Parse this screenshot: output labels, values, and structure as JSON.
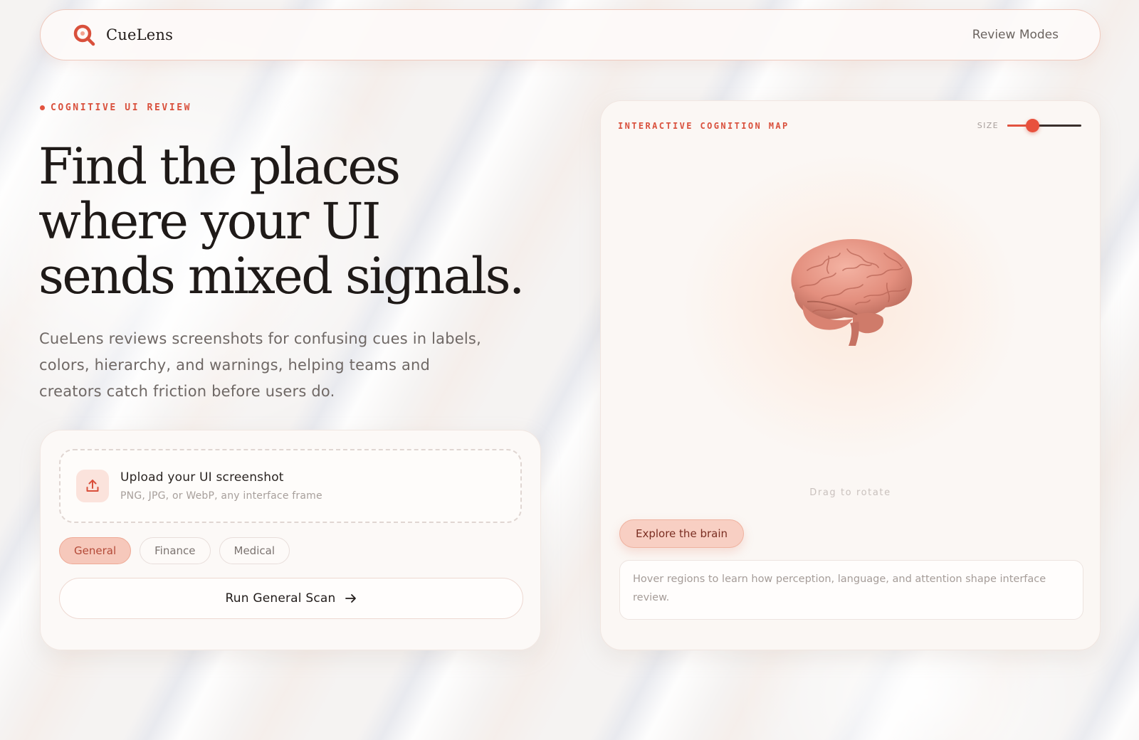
{
  "nav": {
    "brand_name": "CueLens",
    "review_modes": "Review Modes"
  },
  "hero": {
    "eyebrow": "COGNITIVE UI REVIEW",
    "headline_lines": [
      "Find the places",
      "where your UI",
      "sends mixed signals."
    ],
    "lede": "CueLens reviews screenshots for confusing cues in labels, colors, hierarchy, and warnings, helping teams and creators catch friction before users do."
  },
  "upload": {
    "title": "Upload your UI screenshot",
    "subtitle": "PNG, JPG, or WebP, any interface frame",
    "icon": "upload-icon",
    "modes": [
      {
        "label": "General",
        "active": true
      },
      {
        "label": "Finance",
        "active": false
      },
      {
        "label": "Medical",
        "active": false
      }
    ],
    "run_label": "Run General Scan"
  },
  "map": {
    "title": "INTERACTIVE COGNITION MAP",
    "size_label": "SIZE",
    "size_value": 0.3,
    "drag_hint": "Drag to rotate",
    "explore_label": "Explore the brain",
    "info_text": "Hover regions to learn how perception, language, and attention shape interface review."
  },
  "colors": {
    "accent": "#e2533f",
    "chip_active_bg": "#f6c8bb",
    "brain": "#e9998a"
  }
}
